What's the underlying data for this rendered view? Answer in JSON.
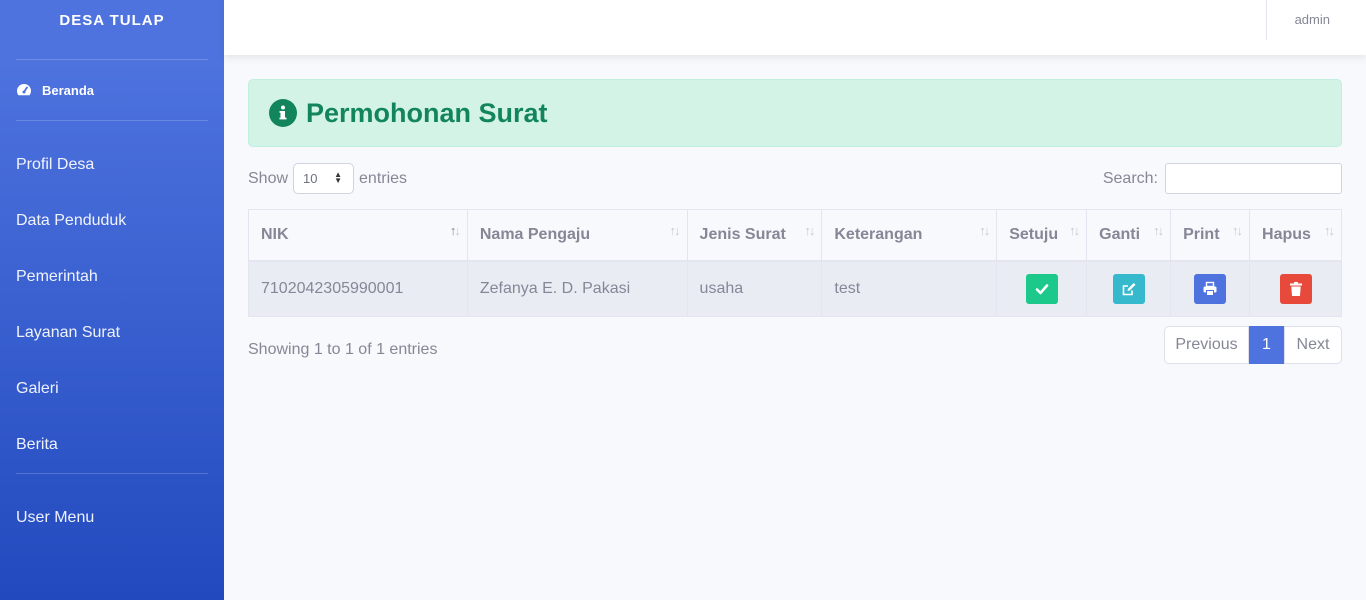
{
  "sidebar": {
    "brand": "DESA TULAP",
    "active": "Beranda",
    "items": [
      {
        "label": "Profil Desa"
      },
      {
        "label": "Data Penduduk"
      },
      {
        "label": "Pemerintah"
      },
      {
        "label": "Layanan Surat"
      },
      {
        "label": "Galeri"
      },
      {
        "label": "Berita"
      }
    ],
    "user_menu": "User Menu"
  },
  "topbar": {
    "user": "admin"
  },
  "alert": {
    "title": "Permohonan Surat"
  },
  "table_controls": {
    "show_label": "Show",
    "entries_value": "10",
    "entries_label": "entries",
    "search_label": "Search:",
    "search_value": ""
  },
  "table": {
    "headers": [
      "NIK",
      "Nama Pengaju",
      "Jenis Surat",
      "Keterangan",
      "Setuju",
      "Ganti",
      "Print",
      "Hapus"
    ],
    "rows": [
      {
        "nik": "7102042305990001",
        "nama": "Zefanya E. D. Pakasi",
        "jenis": "usaha",
        "keterangan": "test"
      }
    ]
  },
  "footer": {
    "info": "Showing 1 to 1 of 1 entries",
    "previous": "Previous",
    "page": "1",
    "next": "Next"
  },
  "colors": {
    "sidebar": "#4e73df",
    "success": "#1cc88a",
    "info": "#36b9cc",
    "primary": "#4e73df",
    "danger": "#e74a3b"
  },
  "icons": [
    "tachometer-icon",
    "info-circle-icon",
    "check-icon",
    "edit-icon",
    "print-icon",
    "trash-icon"
  ]
}
